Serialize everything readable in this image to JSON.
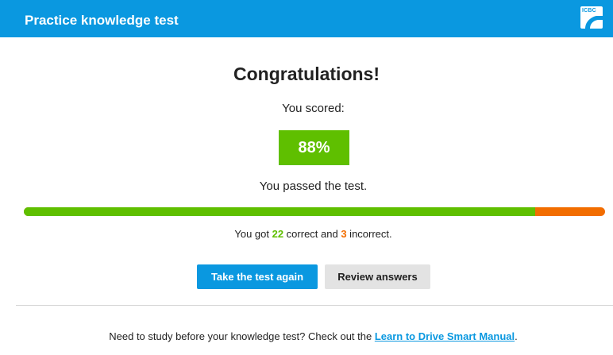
{
  "header": {
    "title": "Practice knowledge test",
    "logo_text": "ICBC"
  },
  "result": {
    "heading": "Congratulations!",
    "scored_label": "You scored:",
    "score": "88%",
    "score_fraction": 0.88,
    "status": "You passed the test.",
    "summary_prefix": "You got ",
    "correct_count": "22",
    "summary_middle": " correct and ",
    "incorrect_count": "3",
    "summary_suffix": " incorrect."
  },
  "buttons": {
    "retake": "Take the test again",
    "review": "Review answers"
  },
  "footer": {
    "text": "Need to study before your knowledge test? Check out the ",
    "link": "Learn to Drive Smart Manual",
    "suffix": "."
  },
  "colors": {
    "brand_blue": "#0a98e0",
    "correct_green": "#5fbf00",
    "incorrect_orange": "#f26d00"
  }
}
